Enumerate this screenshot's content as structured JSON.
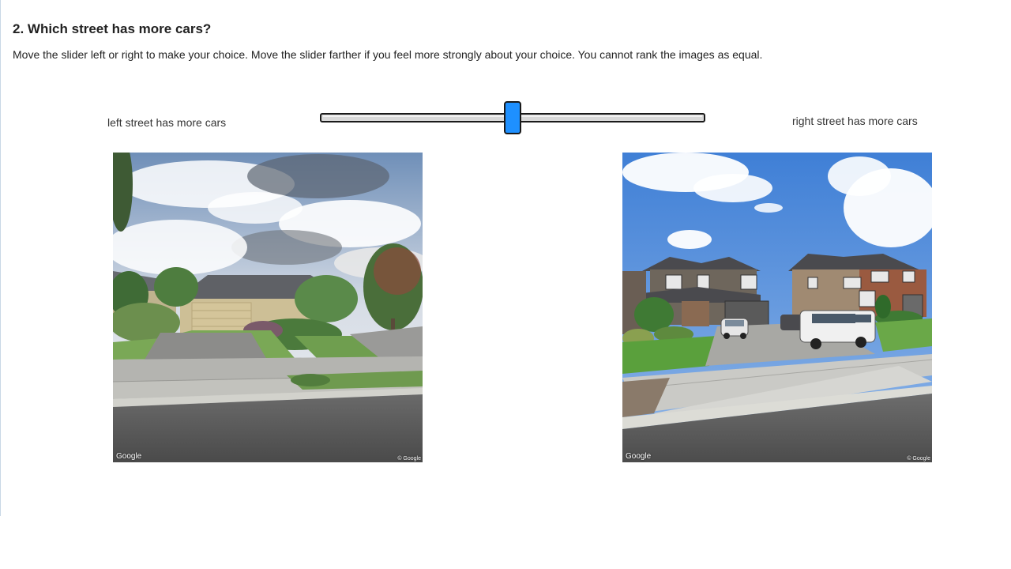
{
  "question": {
    "title": "2. Which street has more cars?",
    "instructions": "Move the slider left or right to make your choice. Move the slider farther if you feel more strongly about your choice. You cannot rank the images as equal."
  },
  "slider": {
    "left_label": "left street has more cars",
    "right_label": "right street has more cars",
    "value_fraction": 0.5
  },
  "images": {
    "left": {
      "description": "Street view of a single-story tan house with garage, cloudy sky, sidewalk and road",
      "watermark": "Google",
      "copyright": "© Google"
    },
    "right": {
      "description": "Street view of two-story houses with driveway, a white SUV and small white car parked, blue sky with clouds",
      "watermark": "Google",
      "copyright": "© Google"
    }
  },
  "colors": {
    "thumb": "#1e90ff",
    "track": "#d9d9d9",
    "text": "#222222"
  }
}
